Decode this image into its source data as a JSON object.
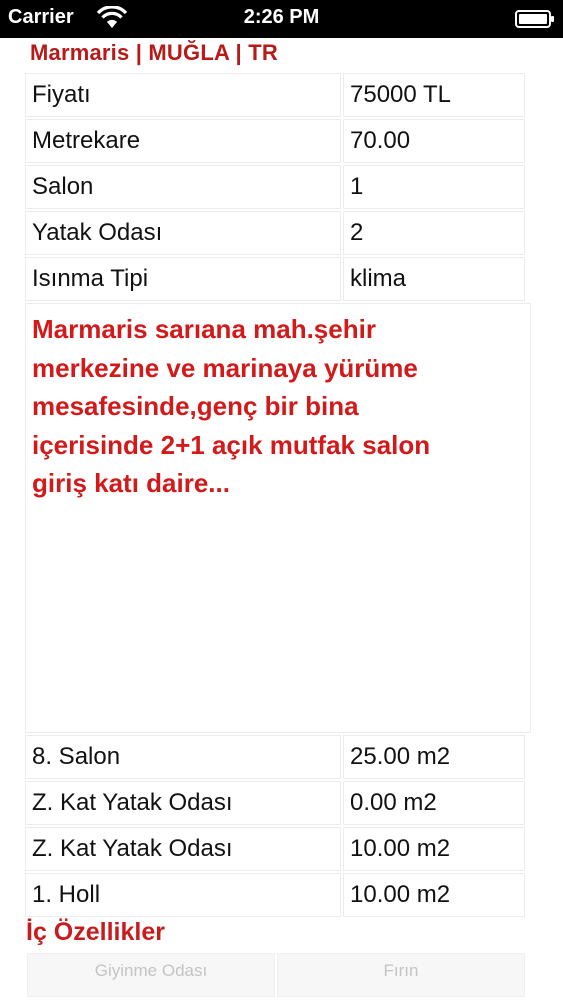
{
  "status_bar": {
    "carrier": "Carrier",
    "time": "2:26 PM",
    "wifi_icon": "wifi-icon",
    "battery_icon": "battery-icon"
  },
  "listing": {
    "location": "Marmaris | MUĞLA | TR",
    "details": [
      {
        "label": "Fiyatı",
        "value": "75000 TL"
      },
      {
        "label": "Metrekare",
        "value": "70.00"
      },
      {
        "label": "Salon",
        "value": "1"
      },
      {
        "label": "Yatak Odası",
        "value": "2"
      },
      {
        "label": "Isınma Tipi",
        "value": "klima"
      }
    ],
    "description_lines": [
      "Marmaris sarıana mah.şehir",
      "merkezine ve marinaya yürüme",
      "mesafesinde,genç bir bina",
      "içerisinde 2+1 açık mutfak salon",
      "giriş katı daire..."
    ],
    "rooms": [
      {
        "label": "8. Salon",
        "value": "25.00 m2"
      },
      {
        "label": "Z. Kat Yatak Odası",
        "value": "0.00 m2"
      },
      {
        "label": "Z. Kat Yatak Odası",
        "value": "10.00 m2"
      },
      {
        "label": "1. Holl",
        "value": "10.00 m2"
      }
    ],
    "interior_features_title": "İç Özellikler",
    "interior_features": [
      "Giyinme Odası",
      "Fırın"
    ]
  },
  "colors": {
    "accent_red": "#d21a1a",
    "title_red": "#b81a1a",
    "status_bar": "#000000"
  }
}
